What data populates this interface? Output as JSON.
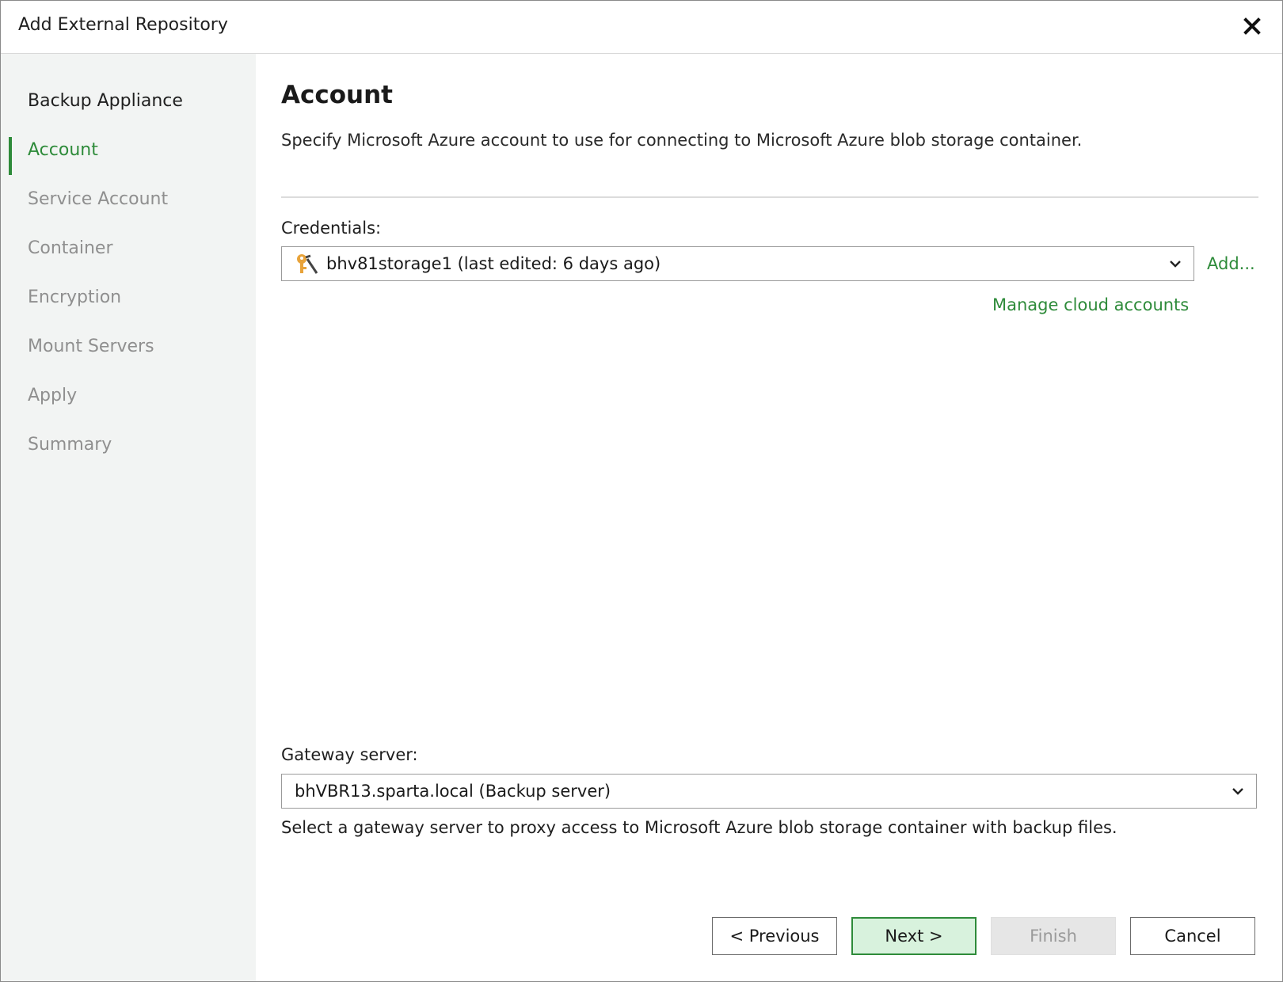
{
  "window": {
    "title": "Add External Repository"
  },
  "sidebar": {
    "items": [
      {
        "label": "Backup Appliance",
        "state": "completed"
      },
      {
        "label": "Account",
        "state": "current"
      },
      {
        "label": "Service Account",
        "state": "pending"
      },
      {
        "label": "Container",
        "state": "pending"
      },
      {
        "label": "Encryption",
        "state": "pending"
      },
      {
        "label": "Mount Servers",
        "state": "pending"
      },
      {
        "label": "Apply",
        "state": "pending"
      },
      {
        "label": "Summary",
        "state": "pending"
      }
    ]
  },
  "main": {
    "title": "Account",
    "description": "Specify Microsoft Azure account to use for connecting to Microsoft Azure blob storage container.",
    "credentials": {
      "label": "Credentials:",
      "value": "bhv81storage1 (last edited: 6 days ago)",
      "icon": "key-icon",
      "add_link": "Add...",
      "manage_link": "Manage cloud accounts"
    },
    "gateway": {
      "label": "Gateway server:",
      "value": "bhVBR13.sparta.local (Backup server)",
      "hint": "Select a gateway server to proxy access to Microsoft Azure blob storage container with backup files."
    }
  },
  "buttons": {
    "previous": "< Previous",
    "next": "Next >",
    "finish": "Finish",
    "cancel": "Cancel"
  },
  "colors": {
    "accent": "#2e8b3a",
    "sidebar_bg": "#f2f4f3",
    "primary_button_bg": "#d8f2dd"
  }
}
